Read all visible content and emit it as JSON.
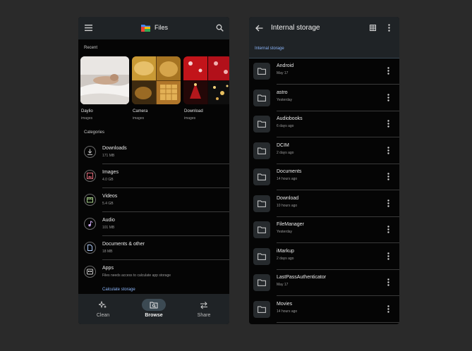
{
  "left": {
    "app_title": "Files",
    "recent_label": "Recent",
    "recent": [
      {
        "name": "Daylio",
        "type": "images"
      },
      {
        "name": "Camera",
        "type": "images"
      },
      {
        "name": "Download",
        "type": "images"
      }
    ],
    "categories_label": "Categories",
    "categories": [
      {
        "name": "Downloads",
        "size": "171 MB",
        "icon": "download-icon"
      },
      {
        "name": "Images",
        "size": "4.0 GB",
        "icon": "image-icon"
      },
      {
        "name": "Videos",
        "size": "5.4 GB",
        "icon": "video-icon"
      },
      {
        "name": "Audio",
        "size": "101 MB",
        "icon": "audio-icon"
      },
      {
        "name": "Documents & other",
        "size": "18 MB",
        "icon": "document-icon"
      },
      {
        "name": "Apps",
        "size": "Files needs access to calculate app storage",
        "icon": "apps-icon"
      }
    ],
    "calculate_link": "Calculate storage",
    "nav": [
      {
        "label": "Clean",
        "icon": "sparkle-icon"
      },
      {
        "label": "Browse",
        "icon": "browse-icon"
      },
      {
        "label": "Share",
        "icon": "share-icon"
      }
    ],
    "active_nav": "Browse"
  },
  "right": {
    "title": "Internal storage",
    "breadcrumb": "Internal storage",
    "folders": [
      {
        "name": "Android",
        "date": "May 17"
      },
      {
        "name": "astro",
        "date": "Yesterday"
      },
      {
        "name": "Audiobooks",
        "date": "6 days ago"
      },
      {
        "name": "DCIM",
        "date": "2 days ago"
      },
      {
        "name": "Documents",
        "date": "14 hours ago"
      },
      {
        "name": "Download",
        "date": "10 hours ago"
      },
      {
        "name": "FileManager",
        "date": "Yesterday"
      },
      {
        "name": "iMarkup",
        "date": "2 days ago"
      },
      {
        "name": "LastPassAuthenticator",
        "date": "May 17"
      },
      {
        "name": "Movies",
        "date": "14 hours ago"
      }
    ]
  },
  "colors": {
    "accent": "#8ab4f8",
    "bar_bg": "#1f2326",
    "surface": "#050505",
    "page_bg": "#2a2a2a"
  }
}
